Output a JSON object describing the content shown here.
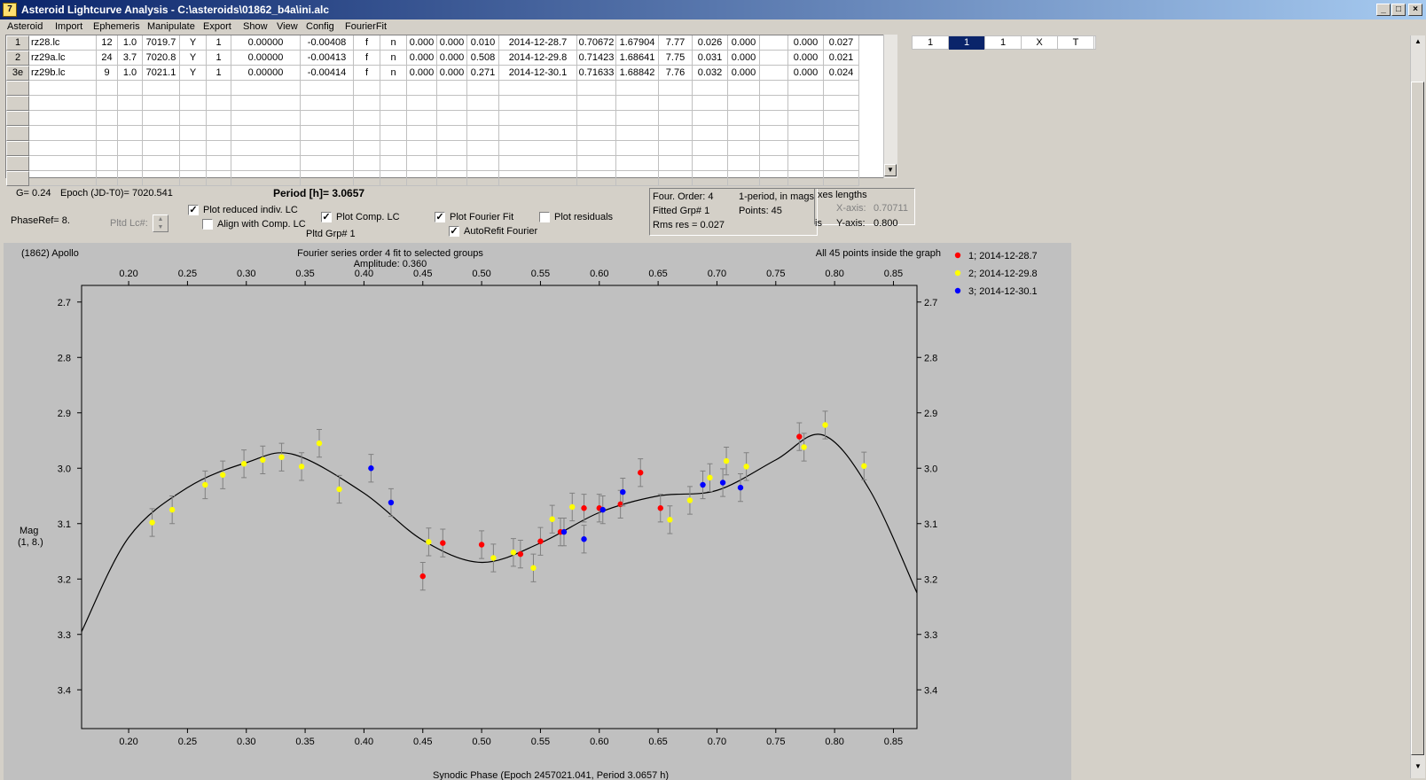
{
  "window": {
    "title": "Asteroid Lightcurve Analysis - C:\\asteroids\\01862_b4a\\ini.alc",
    "app_icon": "lightcurve-app-icon",
    "controls": [
      "_",
      "□",
      "×"
    ]
  },
  "menu": [
    "Asteroid",
    "Import",
    "Ephemeris",
    "Manipulate",
    "Export",
    "Show",
    "View",
    "Config",
    "FourierFit"
  ],
  "grid": {
    "rows": [
      {
        "id": "1",
        "cells": [
          "rz28.lc",
          "12",
          "1.0",
          "7019.7",
          "Y",
          "1",
          "0.00000",
          "-0.00408",
          "f",
          "n",
          "0.000",
          "0.000",
          "0.010",
          "2014-12-28.7",
          "0.70672",
          "1.67904",
          "7.77",
          "0.026",
          "0.000",
          "",
          "0.000",
          "0.027"
        ]
      },
      {
        "id": "2",
        "cells": [
          "rz29a.lc",
          "24",
          "3.7",
          "7020.8",
          "Y",
          "1",
          "0.00000",
          "-0.00413",
          "f",
          "n",
          "0.000",
          "0.000",
          "0.508",
          "2014-12-29.8",
          "0.71423",
          "1.68641",
          "7.75",
          "0.031",
          "0.000",
          "",
          "0.000",
          "0.021"
        ]
      },
      {
        "id": "3e",
        "cells": [
          "rz29b.lc",
          "9",
          "1.0",
          "7021.1",
          "Y",
          "1",
          "0.00000",
          "-0.00414",
          "f",
          "n",
          "0.000",
          "0.000",
          "0.271",
          "2014-12-30.1",
          "0.71633",
          "1.68842",
          "7.76",
          "0.032",
          "0.000",
          "",
          "0.000",
          "0.024"
        ]
      }
    ]
  },
  "selector": [
    "1",
    "1",
    "1",
    "X",
    "T"
  ],
  "info": {
    "g": "G= 0.24",
    "epoch": "Epoch (JD-T0)= 7020.541",
    "period": "Period [h]= 3.0657",
    "phaseref": "PhaseRef= 8.",
    "pltd_lc": "Pltd Lc#:",
    "pltd_grp": "Pltd Grp#  1"
  },
  "checkboxes": {
    "plot_reduced": {
      "label": "Plot reduced indiv. LC",
      "checked": true
    },
    "align_comp": {
      "label": "Align with Comp. LC",
      "checked": false
    },
    "plot_comp": {
      "label": "Plot Comp. LC",
      "checked": true
    },
    "plot_fourier": {
      "label": "Plot Fourier Fit",
      "checked": true
    },
    "autorefit": {
      "label": "AutoRefit Fourier",
      "checked": true
    },
    "plot_residuals": {
      "label": "Plot residuals",
      "checked": false
    }
  },
  "fourier": {
    "order": "Four. Order:  4",
    "mode": "1-period, in mags",
    "fitted": "Fitted Grp# 1",
    "points": "Points: 45",
    "rms": "Rms res     = 0.027"
  },
  "axes": {
    "title": "xes lengths",
    "x_label": "X-axis:",
    "x_val": "0.70711",
    "is": "is",
    "y_label": "Y-axis:",
    "y_val": "0.800"
  },
  "plot": {
    "name": "(1862) Apollo",
    "title": "Fourier series order 4 fit to selected groups",
    "amplitude": "Amplitude: 0.360",
    "inside": "All 45 points inside the graph",
    "ylabel1": "Mag",
    "ylabel2": "(1, 8.)",
    "xlabel": "Synodic Phase (Epoch 2457021.041, Period 3.0657 h)"
  },
  "chart_data": {
    "type": "scatter",
    "xlim": [
      0.16,
      0.87
    ],
    "ylim": [
      3.47,
      2.67
    ],
    "xticks": [
      0.2,
      0.25,
      0.3,
      0.35,
      0.4,
      0.45,
      0.5,
      0.55,
      0.6,
      0.65,
      0.7,
      0.75,
      0.8,
      0.85
    ],
    "xtick_labels": [
      "0.20",
      "0.25",
      "0.30",
      "0.35",
      "0.40",
      "0.45",
      "0.50",
      "0.55",
      "0.60",
      "0.65",
      "0.70",
      "0.75",
      "0.80",
      "0.85"
    ],
    "yticks": [
      2.7,
      2.8,
      2.9,
      3.0,
      3.1,
      3.2,
      3.3,
      3.4
    ],
    "ytick_labels": [
      "2.7",
      "2.8",
      "2.9",
      "3.0",
      "3.1",
      "3.2",
      "3.3",
      "3.4"
    ],
    "colors": {
      "red": "#ff0000",
      "yellow": "#ffff00",
      "blue": "#0000ff",
      "curve": "#000000",
      "errorbar": "#808080"
    },
    "series": [
      {
        "name": "1; 2014-12-28.7",
        "color": "#ff0000",
        "err": 0.025,
        "x": [
          0.45,
          0.467,
          0.5,
          0.533,
          0.55,
          0.567,
          0.587,
          0.6,
          0.618,
          0.635,
          0.652,
          0.77
        ],
        "y": [
          3.195,
          3.135,
          3.138,
          3.155,
          3.132,
          3.115,
          3.072,
          3.072,
          3.065,
          3.008,
          3.072,
          2.943
        ]
      },
      {
        "name": "2; 2014-12-29.8",
        "color": "#ffff00",
        "err": 0.025,
        "x": [
          0.22,
          0.237,
          0.265,
          0.28,
          0.298,
          0.314,
          0.33,
          0.347,
          0.362,
          0.379,
          0.455,
          0.51,
          0.527,
          0.544,
          0.56,
          0.577,
          0.66,
          0.677,
          0.694,
          0.708,
          0.725,
          0.774,
          0.792,
          0.825
        ],
        "y": [
          3.098,
          3.075,
          3.03,
          3.012,
          2.992,
          2.985,
          2.98,
          2.997,
          2.955,
          3.038,
          3.133,
          3.162,
          3.152,
          3.18,
          3.092,
          3.07,
          3.093,
          3.058,
          3.017,
          2.987,
          2.997,
          2.962,
          2.922,
          2.996
        ]
      },
      {
        "name": "3; 2014-12-30.1",
        "color": "#0000ff",
        "err": 0.025,
        "x": [
          0.406,
          0.423,
          0.57,
          0.587,
          0.603,
          0.62,
          0.688,
          0.705,
          0.72
        ],
        "y": [
          3.0,
          3.062,
          3.115,
          3.128,
          3.075,
          3.043,
          3.03,
          3.026,
          3.035
        ]
      }
    ],
    "fit_curve": {
      "x": [
        0.16,
        0.2,
        0.25,
        0.3,
        0.34,
        0.4,
        0.45,
        0.5,
        0.55,
        0.6,
        0.65,
        0.7,
        0.75,
        0.79,
        0.83,
        0.87
      ],
      "y": [
        3.295,
        3.125,
        3.035,
        2.99,
        2.975,
        3.045,
        3.13,
        3.17,
        3.135,
        3.08,
        3.05,
        3.04,
        2.985,
        2.94,
        3.04,
        3.225
      ]
    }
  }
}
